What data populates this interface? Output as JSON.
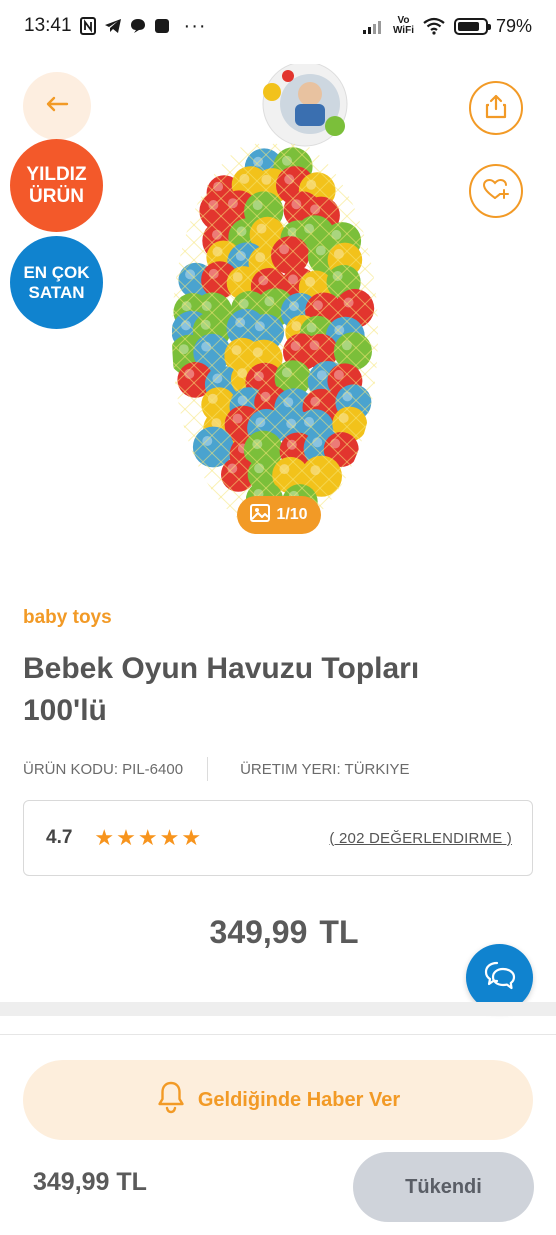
{
  "status_bar": {
    "time": "13:41",
    "battery_percent": "79%",
    "battery_level": 0.79,
    "vowifi_top": "Vo",
    "vowifi_bottom": "WiFi",
    "dots": "···"
  },
  "badges": {
    "star_line1": "YILDIZ",
    "star_line2": "ÜRÜN",
    "best_line1": "EN ÇOK",
    "best_line2": "SATAN"
  },
  "image": {
    "counter": "1/10"
  },
  "product": {
    "brand": "baby toys",
    "title_line1": "Bebek Oyun Havuzu Topları",
    "title_line2": "100'lü",
    "code": "ÜRÜN KODU: PIL-6400",
    "origin": "ÜRETIM YERI: TÜRKIYE",
    "rating": "4.7",
    "stars": 5,
    "reviews": "( 202 DEĞERLENDIRME )",
    "price_amount": "349,99",
    "price_currency": "TL"
  },
  "actions": {
    "notify_label": "Geldiğinde Haber Ver",
    "bottom_price": "349,99 TL",
    "soldout_label": "Tükendi"
  },
  "colors": {
    "accent": "#f29a26",
    "star_badge": "#f3592a",
    "best_badge": "#1083cf",
    "chat": "#1083cf"
  },
  "icons": {
    "back": "arrow-left-icon",
    "share": "share-icon",
    "favorite": "heart-plus-icon",
    "gallery": "image-icon",
    "chat": "chat-bubbles-icon",
    "notify": "bell-icon"
  }
}
